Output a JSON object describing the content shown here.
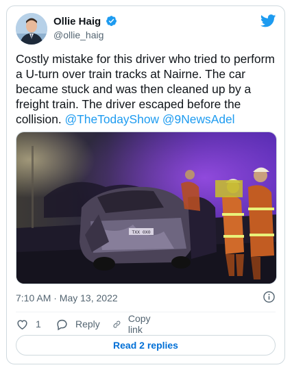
{
  "author": {
    "name": "Ollie Haig",
    "handle": "@ollie_haig",
    "verified": true
  },
  "icons": {
    "brand": "twitter-bird-icon",
    "verified": "verified-badge-icon",
    "info": "info-icon",
    "like": "heart-icon",
    "reply": "reply-bubble-icon",
    "copy": "link-icon"
  },
  "tweet": {
    "text": "Costly mistake for this driver who tried to perform a U-turn over train tracks at Nairne. The car became stuck and was then cleaned up by a freight train. The driver escaped before the collision. ",
    "mentions": [
      "@TheTodayShow",
      "@9NewsAdel"
    ],
    "timestamp": "7:10 AM · May 13, 2022"
  },
  "media": {
    "plate_text": "TXX 0X0"
  },
  "actions": {
    "like_count": "1",
    "reply_label": "Reply",
    "copy_link_label": "Copy link"
  },
  "read_replies_label": "Read 2 replies",
  "colors": {
    "accent": "#1d9bf0",
    "read_button": "#006fd6",
    "muted": "#536471",
    "border": "#cfd9de"
  }
}
